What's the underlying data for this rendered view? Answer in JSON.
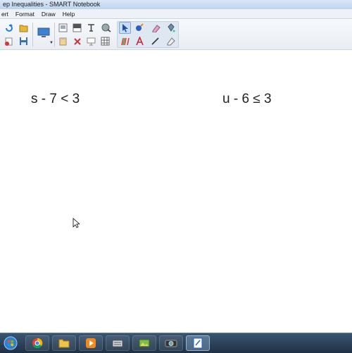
{
  "window": {
    "title": "ep Inequalities - SMART Notebook"
  },
  "menu": {
    "items": [
      "ert",
      "Format",
      "Draw",
      "Help"
    ]
  },
  "canvas": {
    "equation_left": "s - 7 < 3",
    "equation_right": "u - 6 ≤ 3"
  },
  "colors": {
    "titlebar": "#c8dbf1",
    "taskbar": "#2a405a",
    "ink": "#222222"
  }
}
